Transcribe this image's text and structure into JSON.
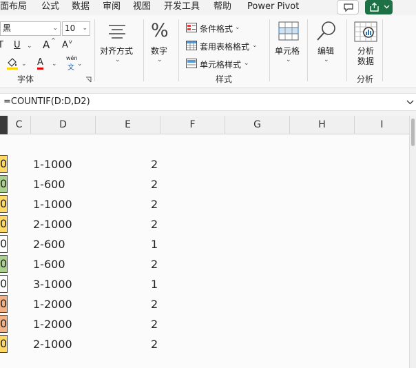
{
  "menu": [
    "面布局",
    "公式",
    "数据",
    "审阅",
    "视图",
    "开发工具",
    "帮助",
    "Power Pivot"
  ],
  "ribbon": {
    "font_name": "黑",
    "font_size": "10",
    "underline": "U",
    "grow_font": "A",
    "shrink_font": "A",
    "font_color": "A",
    "wen_top": "wén",
    "wen_bottom": "文",
    "font_group": "字体",
    "align_label": "对齐方式",
    "number_label": "数字",
    "conditional_format": "条件格式",
    "table_format": "套用表格格式",
    "cell_style": "单元格样式",
    "styles_group": "样式",
    "cells_label": "单元格",
    "edit_label": "编辑",
    "analyze_label_1": "分析",
    "analyze_label_2": "数据",
    "analyze_group": "分析"
  },
  "formula": "=COUNTIF(D:D,D2)",
  "columns": [
    "C",
    "D",
    "E",
    "F",
    "G",
    "H",
    "I"
  ],
  "rows": [
    {
      "c": "0",
      "d": "1-1000",
      "e": "2",
      "color": "#ffd966"
    },
    {
      "c": "0",
      "d": "1-600",
      "e": "2",
      "color": "#a9d08e"
    },
    {
      "c": "0",
      "d": "1-1000",
      "e": "2",
      "color": "#ffd966"
    },
    {
      "c": "0",
      "d": "2-1000",
      "e": "2",
      "color": "#ffd966"
    },
    {
      "c": "0",
      "d": "2-600",
      "e": "1",
      "color": "#ffffff"
    },
    {
      "c": "0",
      "d": "1-600",
      "e": "2",
      "color": "#a9d08e"
    },
    {
      "c": "0",
      "d": "3-1000",
      "e": "1",
      "color": "#ffffff"
    },
    {
      "c": "0",
      "d": "1-2000",
      "e": "2",
      "color": "#f4b183"
    },
    {
      "c": "0",
      "d": "1-2000",
      "e": "2",
      "color": "#f4b183"
    },
    {
      "c": "0",
      "d": "2-1000",
      "e": "2",
      "color": "#ffd966"
    }
  ]
}
